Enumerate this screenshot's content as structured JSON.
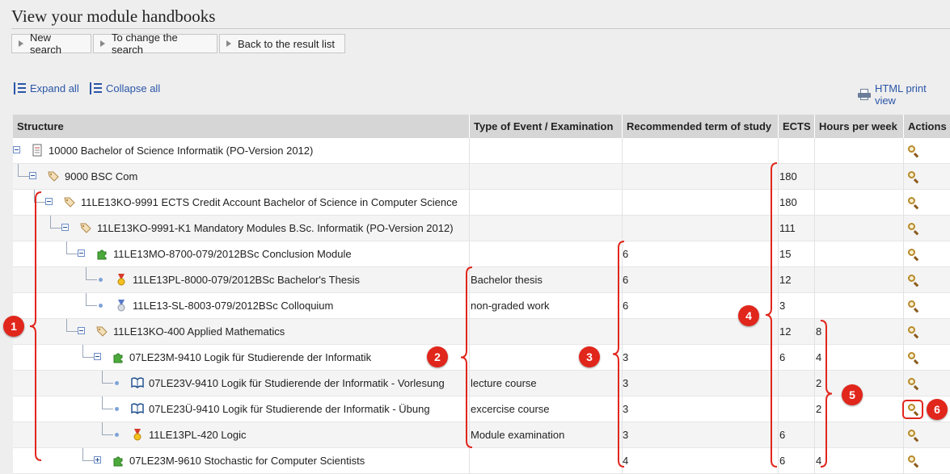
{
  "page": {
    "title": "View your module handbooks"
  },
  "nav": {
    "new_search": "New search",
    "change_search": "To change the search",
    "back_to_results": "Back to the result list"
  },
  "tools": {
    "expand_all": "Expand all",
    "collapse_all": "Collapse all",
    "print_view": "HTML print view"
  },
  "table": {
    "headers": [
      "Structure",
      "Type of Event / Examination",
      "Recommended term of study",
      "ECTS",
      "Hours per week",
      "Actions"
    ],
    "rows": [
      {
        "label": "10000 Bachelor of Science Informatik (PO-Version 2012)",
        "type": "",
        "term": "",
        "ects": "",
        "hours": "",
        "icon": "document-icon",
        "toggle": "minus"
      },
      {
        "label": "9000 BSC Com",
        "type": "",
        "term": "",
        "ects": "180",
        "hours": "",
        "icon": "tag-icon",
        "toggle": "minus"
      },
      {
        "label": "11LE13KO-9991 ECTS Credit Account Bachelor of Science in Computer Science",
        "type": "",
        "term": "",
        "ects": "180",
        "hours": "",
        "icon": "tag-icon",
        "toggle": "minus"
      },
      {
        "label": "11LE13KO-9991-K1 Mandatory Modules B.Sc. Informatik (PO-Version 2012)",
        "type": "",
        "term": "",
        "ects": "111",
        "hours": "",
        "icon": "tag-icon",
        "toggle": "minus"
      },
      {
        "label": "11LE13MO-8700-079/2012BSc Conclusion Module",
        "type": "",
        "term": "6",
        "ects": "15",
        "hours": "",
        "icon": "puzzle-icon",
        "toggle": "minus"
      },
      {
        "label": "11LE13PL-8000-079/2012BSc Bachelor's Thesis",
        "type": "Bachelor thesis",
        "term": "6",
        "ects": "12",
        "hours": "",
        "icon": "medal-gold-icon",
        "toggle": "dot"
      },
      {
        "label": "11LE13-SL-8003-079/2012BSc Colloquium",
        "type": "non-graded work",
        "term": "6",
        "ects": "3",
        "hours": "",
        "icon": "medal-silver-icon",
        "toggle": "dot"
      },
      {
        "label": "11LE13KO-400 Applied Mathematics",
        "type": "",
        "term": "",
        "ects": "12",
        "hours": "8",
        "icon": "tag-icon",
        "toggle": "minus"
      },
      {
        "label": "07LE23M-9410 Logik für Studierende der Informatik",
        "type": "",
        "term": "3",
        "ects": "6",
        "hours": "4",
        "icon": "puzzle-icon",
        "toggle": "minus"
      },
      {
        "label": "07LE23V-9410 Logik für Studierende der Informatik - Vorlesung",
        "type": "lecture course",
        "term": "3",
        "ects": "",
        "hours": "2",
        "icon": "book-icon",
        "toggle": "dot"
      },
      {
        "label": "07LE23Ü-9410 Logik für Studierende der Informatik - Übung",
        "type": "excercise course",
        "term": "3",
        "ects": "",
        "hours": "2",
        "icon": "book-icon",
        "toggle": "dot"
      },
      {
        "label": "11LE13PL-420 Logic",
        "type": "Module examination",
        "term": "3",
        "ects": "6",
        "hours": "",
        "icon": "medal-gold-icon",
        "toggle": "dot"
      },
      {
        "label": "07LE23M-9610 Stochastic for Computer Scientists",
        "type": "",
        "term": "4",
        "ects": "6",
        "hours": "4",
        "icon": "puzzle-icon",
        "toggle": "plus"
      }
    ]
  },
  "annotations": [
    "1",
    "2",
    "3",
    "4",
    "5",
    "6"
  ],
  "colors": {
    "annotation": "#e1261c",
    "link": "#2a55a8",
    "header_bg": "#d6d6d6"
  }
}
